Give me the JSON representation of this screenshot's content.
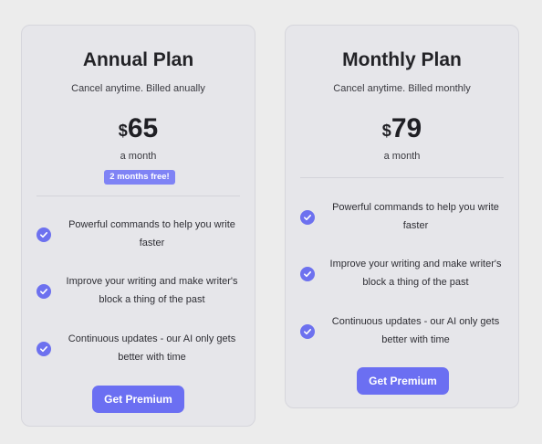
{
  "plans": [
    {
      "title": "Annual Plan",
      "subtitle": "Cancel anytime. Billed anually",
      "currency": "$",
      "price": "65",
      "period": "a month",
      "badge": "2 months free!",
      "features": [
        "Powerful commands to help you write faster",
        "Improve your writing and make writer's block a thing of the past",
        "Continuous updates - our AI only gets better with time"
      ],
      "button": "Get Premium"
    },
    {
      "title": "Monthly Plan",
      "subtitle": "Cancel anytime. Billed monthly",
      "currency": "$",
      "price": "79",
      "period": "a month",
      "features": [
        "Powerful commands to help you write faster",
        "Improve your writing and make writer's block a thing of the past",
        "Continuous updates - our AI only gets better with time"
      ],
      "button": "Get Premium"
    }
  ],
  "colors": {
    "accent": "#6b6ff2",
    "badge": "#7f83f5",
    "card_bg": "#e6e6ea",
    "page_bg": "#ececec"
  },
  "icons": {
    "feature_check": "check-circle-icon"
  }
}
